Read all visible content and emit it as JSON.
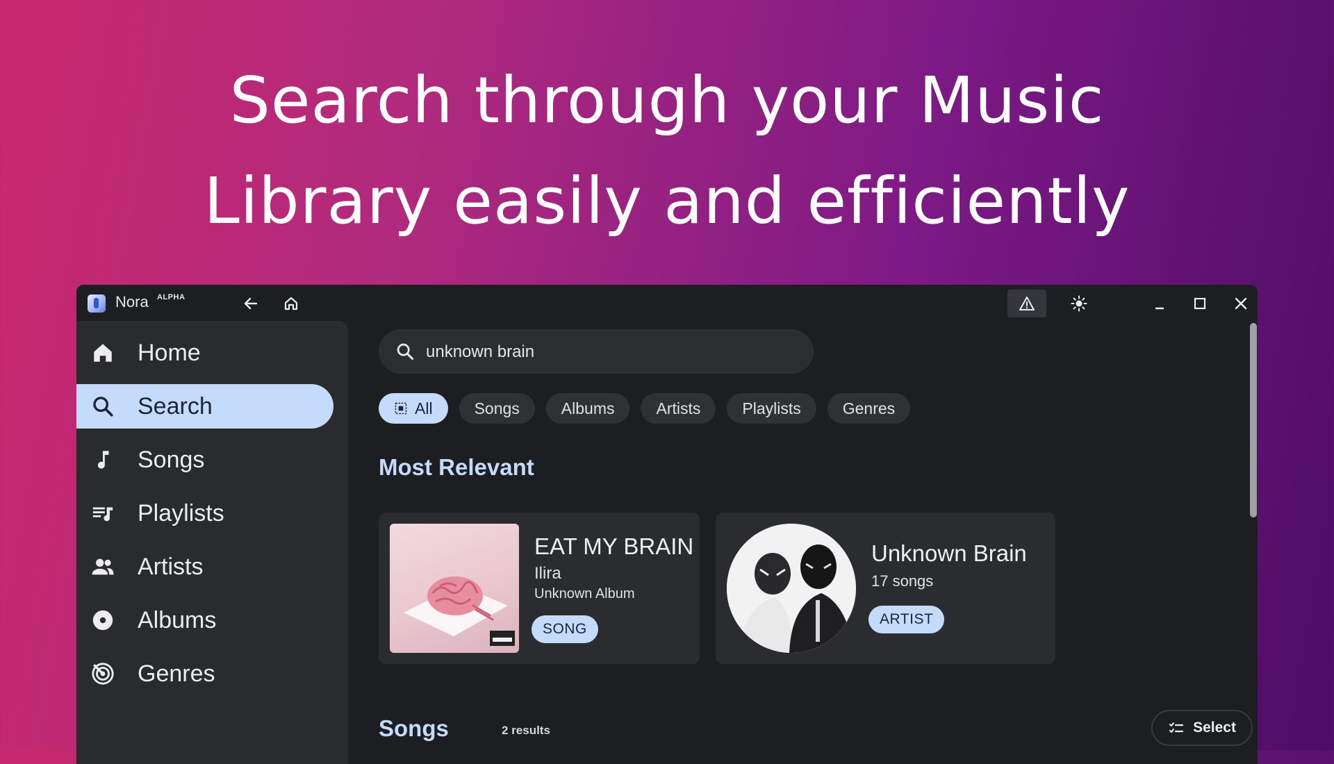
{
  "headline": {
    "line1": "Search through your Music",
    "line2": "Library easily and efficiently"
  },
  "titlebar": {
    "app_name": "Nora",
    "app_tag": "ALPHA",
    "icons": [
      "back-arrow-icon",
      "home-icon",
      "warning-icon",
      "sun-icon",
      "minimize-icon",
      "maximize-icon",
      "close-icon"
    ]
  },
  "sidebar": {
    "items": [
      {
        "label": "Home",
        "icon": "home-icon"
      },
      {
        "label": "Search",
        "icon": "search-icon",
        "active": true
      },
      {
        "label": "Songs",
        "icon": "music-note-icon"
      },
      {
        "label": "Playlists",
        "icon": "playlist-icon"
      },
      {
        "label": "Artists",
        "icon": "artists-icon"
      },
      {
        "label": "Albums",
        "icon": "album-icon"
      },
      {
        "label": "Genres",
        "icon": "genre-icon"
      }
    ]
  },
  "search": {
    "value": "unknown brain"
  },
  "filters": [
    "All",
    "Songs",
    "Albums",
    "Artists",
    "Playlists",
    "Genres"
  ],
  "most_relevant": {
    "title": "Most Relevant",
    "song": {
      "title": "EAT MY BRAIN",
      "artist": "Ilira",
      "album": "Unknown Album",
      "type": "SONG"
    },
    "artist": {
      "name": "Unknown Brain",
      "count": "17 songs",
      "type": "ARTIST"
    }
  },
  "songs_section": {
    "title": "Songs",
    "results": "2 results",
    "select_label": "Select"
  },
  "colors": {
    "accent": "#c5dbfb",
    "window_bg": "#1d1e21",
    "sidebar_bg": "#2a2b2f"
  }
}
